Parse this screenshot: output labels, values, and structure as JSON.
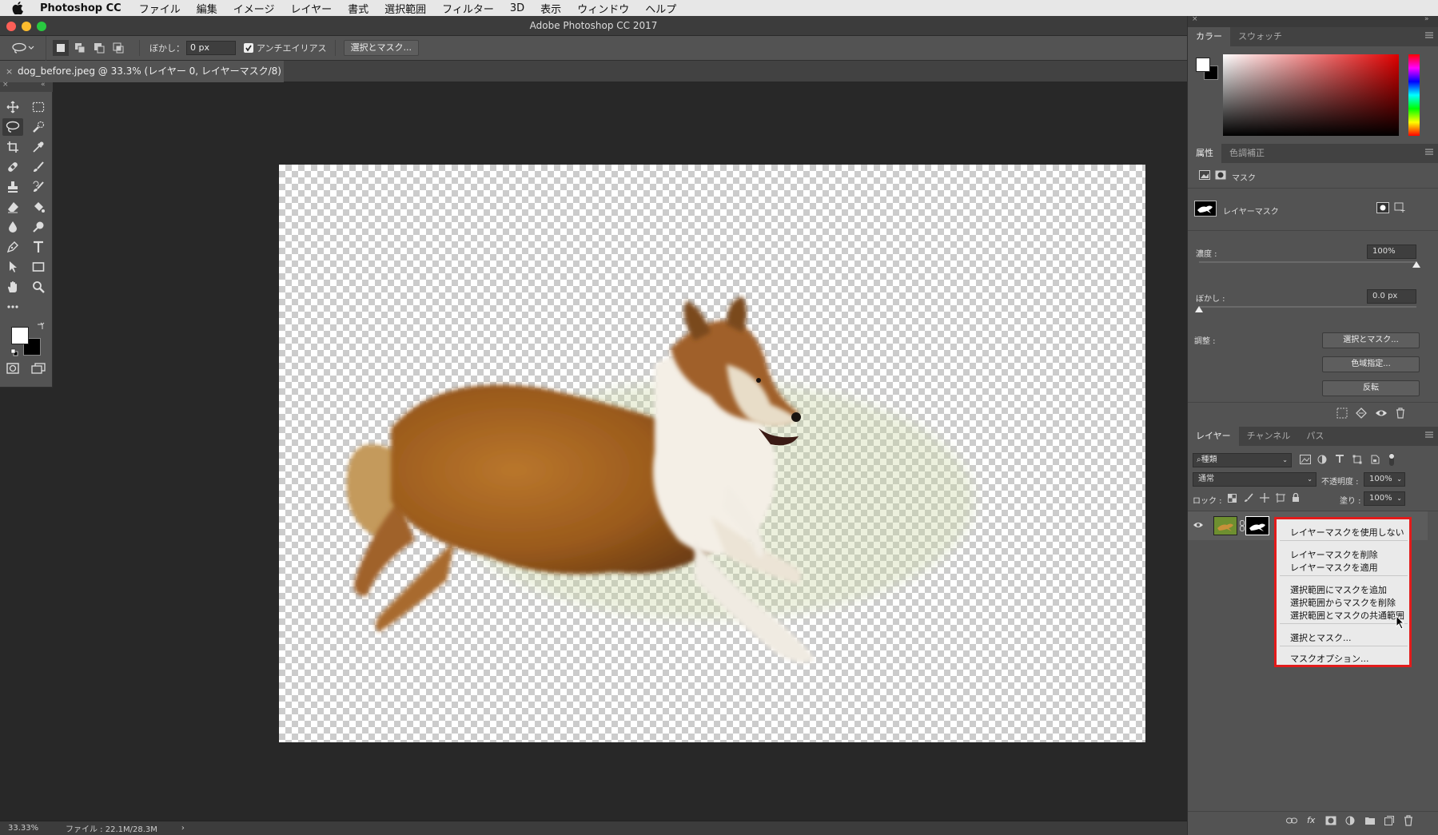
{
  "menubar": {
    "app_name": "Photoshop CC",
    "items": [
      "ファイル",
      "編集",
      "イメージ",
      "レイヤー",
      "書式",
      "選択範囲",
      "フィルター",
      "3D",
      "表示",
      "ウィンドウ",
      "ヘルプ"
    ]
  },
  "window": {
    "title": "Adobe Photoshop CC 2017"
  },
  "options_bar": {
    "feather_label": "ぼかし：",
    "feather_value": "0 px",
    "antialias_label": "アンチエイリアス",
    "antialias_checked": true,
    "select_mask_button": "選択とマスク..."
  },
  "document_tab": {
    "label": "dog_before.jpeg @ 33.3% (レイヤー 0, レイヤーマスク/8) *"
  },
  "status_bar": {
    "zoom": "33.33%",
    "file_info": "ファイル : 22.1M/28.3M"
  },
  "color_panel": {
    "tabs": [
      "カラー",
      "スウォッチ"
    ],
    "active_tab": "カラー"
  },
  "properties_panel": {
    "tabs": [
      "属性",
      "色調補正"
    ],
    "active_tab": "属性",
    "mask_heading": "マスク",
    "layer_mask_label": "レイヤーマスク",
    "density_label": "濃度 :",
    "density_value": "100%",
    "feather_label": "ぼかし :",
    "feather_value": "0.0 px",
    "adjust_label": "調整 :",
    "buttons": [
      "選択とマスク...",
      "色域指定...",
      "反転"
    ],
    "density_level": 1.0,
    "feather_level": 0.0
  },
  "layers_panel": {
    "tabs": [
      "レイヤー",
      "チャンネル",
      "パス"
    ],
    "active_tab": "レイヤー",
    "filter_label": "種類",
    "blend_mode": "通常",
    "opacity_label": "不透明度 :",
    "opacity_value": "100%",
    "lock_label": "ロック :",
    "fill_label": "塗り :",
    "fill_value": "100%"
  },
  "context_menu": {
    "items": [
      "レイヤーマスクを使用しない",
      "レイヤーマスクを削除",
      "レイヤーマスクを適用",
      "選択範囲にマスクを追加",
      "選択範囲からマスクを削除",
      "選択範囲とマスクの共通範囲",
      "選択とマスク...",
      "マスクオプション..."
    ]
  },
  "colors": {
    "highlight_border": "#e31b1b",
    "panel_bg": "#535353",
    "workspace_bg": "#282828"
  }
}
